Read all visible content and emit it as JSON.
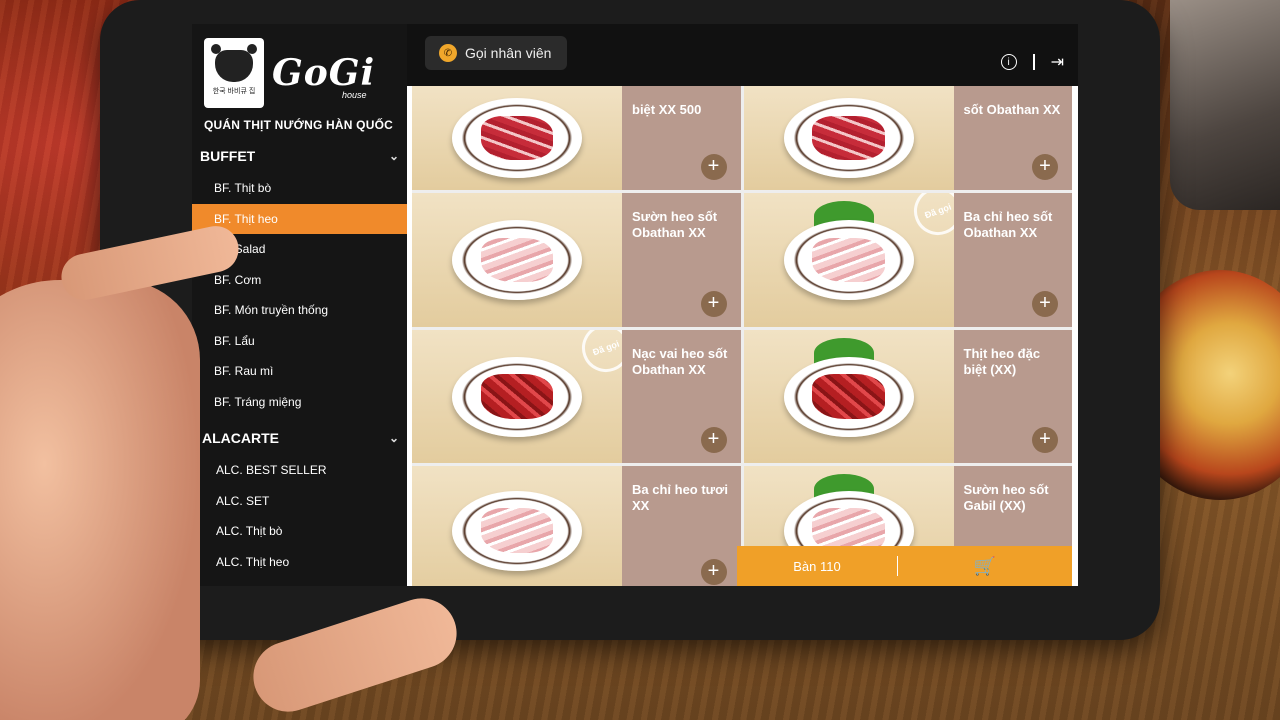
{
  "sidebar": {
    "logo": {
      "brand": "GoGi",
      "brand_sub": "house",
      "cow_sub": "한국 바비큐 집",
      "tagline": "QUÁN THỊT NƯỚNG HÀN QUỐC"
    },
    "buffet": {
      "header": "BUFFET",
      "items": [
        "BF. Thịt bò",
        "BF. Thịt heo",
        "BF. Salad",
        "BF. Cơm",
        "BF. Món truyền thống",
        "BF. Lẩu",
        "BF. Rau mì",
        "BF. Tráng miệng"
      ],
      "active_index": 1
    },
    "alacarte": {
      "header": "ALACARTE",
      "items": [
        "ALC. BEST SELLER",
        "ALC. SET",
        "ALC. Thịt bò",
        "ALC. Thịt heo"
      ]
    }
  },
  "topbar": {
    "call_staff_label": "Gọi nhân viên",
    "info_icon": "info-icon",
    "exit_icon": "logout-icon"
  },
  "menu_items": [
    {
      "name": "biệt XX 500",
      "meat": "beef",
      "ordered": false
    },
    {
      "name": "sốt Obathan XX",
      "meat": "beef",
      "ordered": false
    },
    {
      "name": "Sườn heo sốt Obathan XX",
      "meat": "pork",
      "ordered": false
    },
    {
      "name": "Ba chỉ heo sốt Obathan XX",
      "meat": "pork",
      "ordered": true
    },
    {
      "name": "Nạc vai heo sốt Obathan XX",
      "meat": "marinated",
      "ordered": true
    },
    {
      "name": "Thịt heo đặc biệt (XX)",
      "meat": "marinated",
      "ordered": false
    },
    {
      "name": "Ba chỉ heo tươi XX",
      "meat": "pork",
      "ordered": false
    },
    {
      "name": "Sườn heo sốt Gabil (XX)",
      "meat": "pork",
      "ordered": false
    }
  ],
  "ordered_stamp": "Đã gọi",
  "add_label": "+",
  "bottom_bar": {
    "table_label": "Bàn 110",
    "cart_icon": "cart-icon"
  }
}
